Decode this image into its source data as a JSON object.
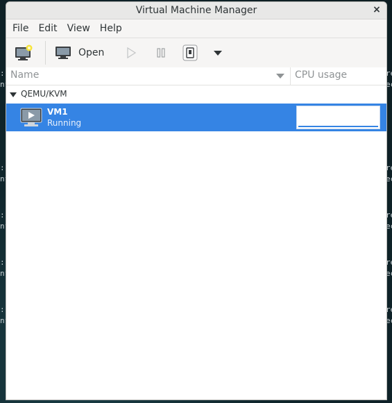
{
  "window": {
    "title": "Virtual Machine Manager",
    "close_glyph": "×"
  },
  "menu": [
    "File",
    "Edit",
    "View",
    "Help"
  ],
  "toolbar": {
    "new_vm_icon": "new-vm-icon",
    "open_label": "Open",
    "run_icon": "play-icon",
    "pause_icon": "pause-icon",
    "shutdown_icon": "shutdown-icon",
    "menu_icon": "chevron-down-icon"
  },
  "columns": {
    "name": "Name",
    "cpu": "CPU usage"
  },
  "connection": {
    "label": "QEMU/KVM"
  },
  "vms": [
    {
      "name": "VM1",
      "status": "Running",
      "cpu_usage": 0.0,
      "selected": true
    }
  ],
  "colors": {
    "selection": "#3584e4"
  }
}
